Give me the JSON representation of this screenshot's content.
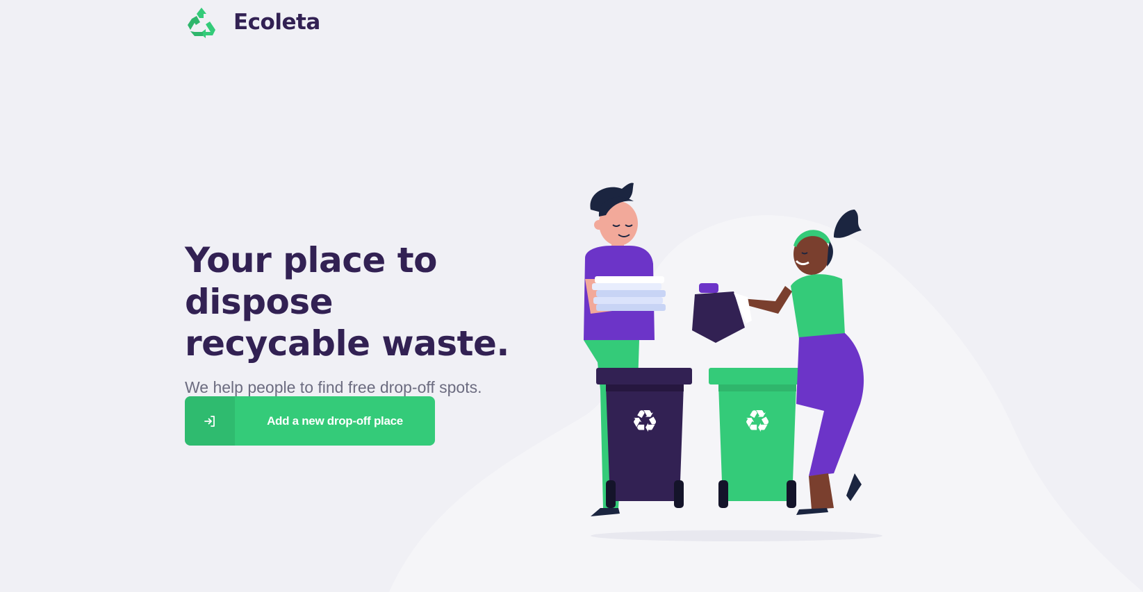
{
  "header": {
    "logo_icon": "recycle-icon",
    "brand_name": "Ecoleta"
  },
  "hero": {
    "headline_line1": "Your place to dispose",
    "headline_line2": "recycable waste.",
    "subtitle": "We help people to find free drop-off spots."
  },
  "cta": {
    "icon": "log-in-icon",
    "label": "Add a new drop-off place"
  },
  "colors": {
    "background": "#f0f0f5",
    "primary": "#34cb79",
    "title": "#322153",
    "text": "#6c6c80",
    "accent_purple": "#6c34c8"
  },
  "illustration": {
    "description_icon": "people-recycling-illustration"
  }
}
